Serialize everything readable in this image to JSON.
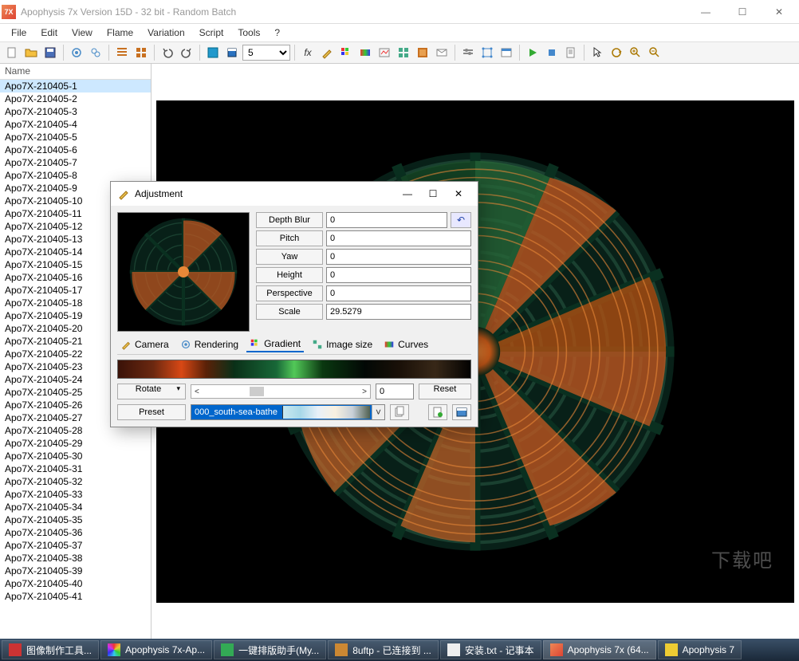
{
  "window": {
    "title": "Apophysis 7x Version 15D  - 32 bit - Random Batch",
    "app_icon_text": "7X"
  },
  "menu": [
    "File",
    "Edit",
    "View",
    "Flame",
    "Variation",
    "Script",
    "Tools",
    "?"
  ],
  "toolbar": {
    "quality_value": "5"
  },
  "sidebar": {
    "header": "Name",
    "items": [
      "Apo7X-210405-1",
      "Apo7X-210405-2",
      "Apo7X-210405-3",
      "Apo7X-210405-4",
      "Apo7X-210405-5",
      "Apo7X-210405-6",
      "Apo7X-210405-7",
      "Apo7X-210405-8",
      "Apo7X-210405-9",
      "Apo7X-210405-10",
      "Apo7X-210405-11",
      "Apo7X-210405-12",
      "Apo7X-210405-13",
      "Apo7X-210405-14",
      "Apo7X-210405-15",
      "Apo7X-210405-16",
      "Apo7X-210405-17",
      "Apo7X-210405-18",
      "Apo7X-210405-19",
      "Apo7X-210405-20",
      "Apo7X-210405-21",
      "Apo7X-210405-22",
      "Apo7X-210405-23",
      "Apo7X-210405-24",
      "Apo7X-210405-25",
      "Apo7X-210405-26",
      "Apo7X-210405-27",
      "Apo7X-210405-28",
      "Apo7X-210405-29",
      "Apo7X-210405-30",
      "Apo7X-210405-31",
      "Apo7X-210405-32",
      "Apo7X-210405-33",
      "Apo7X-210405-34",
      "Apo7X-210405-35",
      "Apo7X-210405-36",
      "Apo7X-210405-37",
      "Apo7X-210405-38",
      "Apo7X-210405-39",
      "Apo7X-210405-40",
      "Apo7X-210405-41"
    ],
    "selected_index": 0
  },
  "watermark": "下载吧",
  "dialog": {
    "title": "Adjustment",
    "params": {
      "depth_blur": {
        "label": "Depth Blur",
        "value": "0"
      },
      "pitch": {
        "label": "Pitch",
        "value": "0"
      },
      "yaw": {
        "label": "Yaw",
        "value": "0"
      },
      "height": {
        "label": "Height",
        "value": "0"
      },
      "perspective": {
        "label": "Perspective",
        "value": "0"
      },
      "scale": {
        "label": "Scale",
        "value": "29.5279"
      }
    },
    "tabs": {
      "camera": "Camera",
      "rendering": "Rendering",
      "gradient": "Gradient",
      "image_size": "Image size",
      "curves": "Curves"
    },
    "rotate_label": "Rotate",
    "slider_value": "0",
    "reset_label": "Reset",
    "preset_label": "Preset",
    "preset_value": "000_south-sea-bathe"
  },
  "taskbar": {
    "items": [
      "图像制作工具...",
      "Apophysis 7x-Ap...",
      "一键排版助手(My...",
      "8uftp - 已连接到 ...",
      "安装.txt - 记事本",
      "Apophysis 7x (64...",
      "Apophysis 7"
    ]
  }
}
